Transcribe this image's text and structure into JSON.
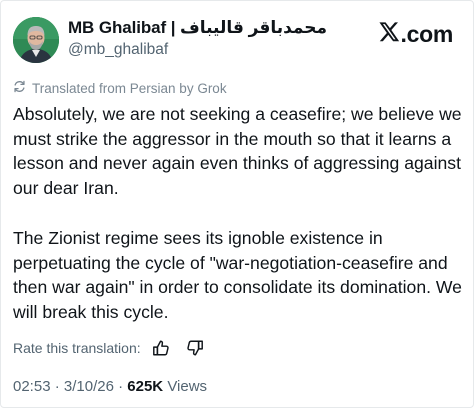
{
  "author": {
    "display_name": "MB Ghalibaf | محمدباقر قالیباف",
    "handle": "@mb_ghalibaf",
    "avatar": "avatar-portrait"
  },
  "brand": {
    "text": ".com",
    "icon": "x-logo-icon"
  },
  "translation_note": {
    "icon": "translate-icon",
    "text": "Translated from Persian by Grok"
  },
  "tweet": {
    "paragraphs": [
      "Absolutely, we are not seeking a ceasefire; we believe we must strike the aggressor in the mouth so that it learns a lesson and never again even thinks of aggressing against our dear Iran.",
      "The Zionist regime sees its ignoble existence in perpetuating the cycle of \"war-negotiation-ceasefire and then war again\" in order to consolidate its domination. We will break this cycle."
    ]
  },
  "rating": {
    "label": "Rate this translation:",
    "icons": [
      "thumbs-up-icon",
      "thumbs-down-icon"
    ]
  },
  "meta": {
    "time": "02:53",
    "date": "3/10/26",
    "separator": "·",
    "views_count": "625K",
    "views_label": "Views"
  },
  "colors": {
    "text_primary": "#0f1419",
    "text_secondary": "#536471",
    "avatar_bg": "#2f8a55"
  }
}
